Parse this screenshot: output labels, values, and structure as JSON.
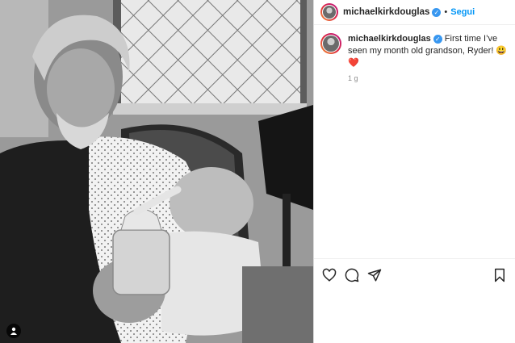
{
  "post": {
    "username": "michaelkirkdouglas",
    "follow_label": "Segui",
    "separator": "•",
    "caption": "First time I’ve seen my month old grandson, Ryder! 😃",
    "caption_emoji_heart": "❤️",
    "timestamp": "1 g"
  },
  "icons": {
    "like": "heart-outline-icon",
    "comment": "comment-bubble-icon",
    "share": "paper-plane-icon",
    "save": "bookmark-icon",
    "tagged": "user-tag-icon",
    "verified": "verified-badge-icon"
  },
  "colors": {
    "accent": "#0095f6",
    "verified": "#3897f0"
  }
}
